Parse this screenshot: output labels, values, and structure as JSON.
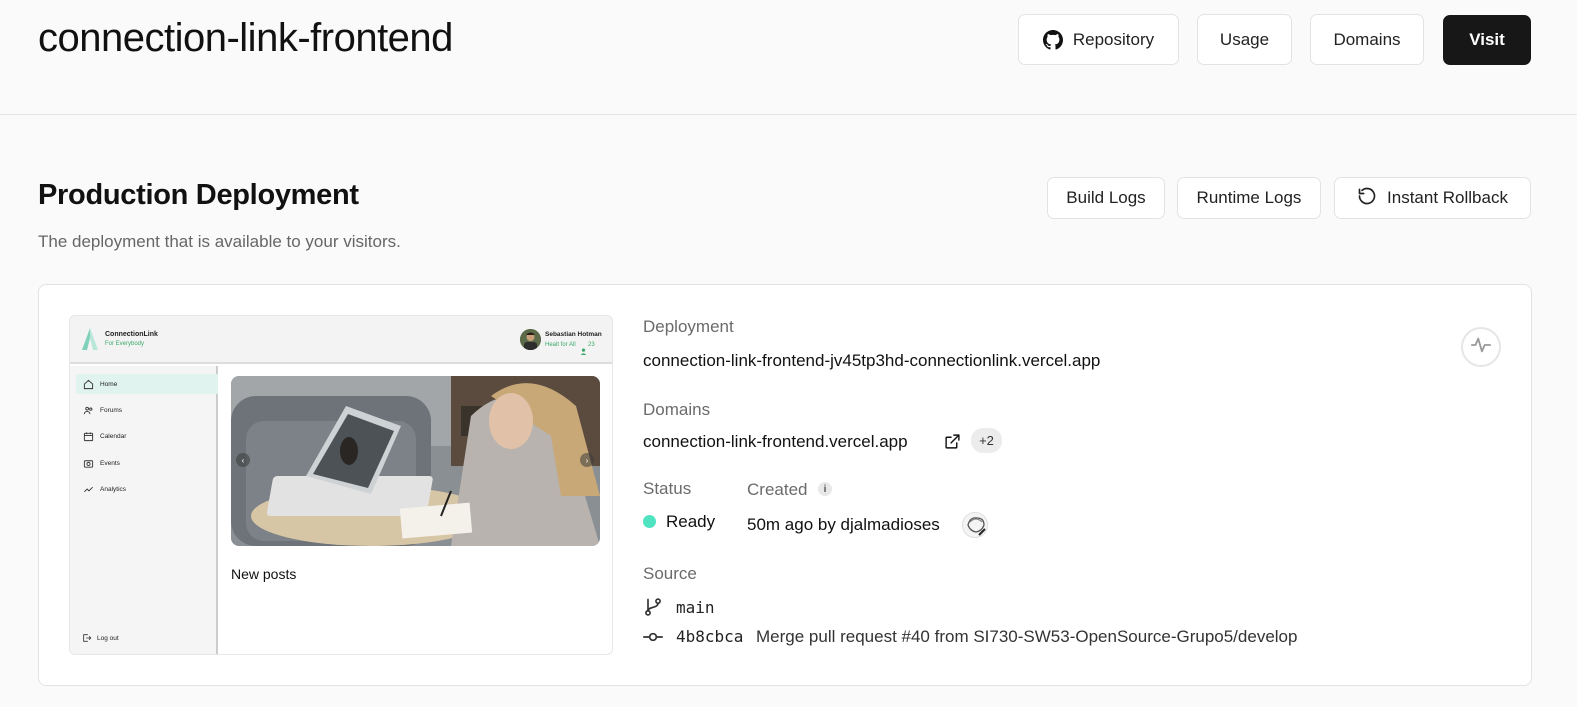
{
  "header": {
    "project_name": "connection-link-frontend",
    "buttons": {
      "repository": "Repository",
      "usage": "Usage",
      "domains": "Domains",
      "visit": "Visit"
    }
  },
  "section": {
    "title": "Production Deployment",
    "subtitle": "The deployment that is available to your visitors.",
    "actions": {
      "build_logs": "Build Logs",
      "runtime_logs": "Runtime Logs",
      "instant_rollback": "Instant Rollback"
    }
  },
  "preview": {
    "brand": "ConnectionLink",
    "tagline": "For Everybody",
    "user_name": "Sebastian Hotman",
    "user_sub": "Healt for All",
    "user_count": "23",
    "nav": [
      "Home",
      "Forums",
      "Calendar",
      "Events",
      "Analytics"
    ],
    "logout": "Log out",
    "arrow_left": "‹",
    "arrow_right": "›",
    "new_posts": "New posts"
  },
  "details": {
    "deployment_label": "Deployment",
    "deployment_url": "connection-link-frontend-jv45tp3hd-connectionlink.vercel.app",
    "domains_label": "Domains",
    "domain": "connection-link-frontend.vercel.app",
    "domains_extra": "+2",
    "status_label": "Status",
    "status_value": "Ready",
    "created_label": "Created",
    "created_info": "i",
    "created_value": "50m ago by djalmadioses",
    "source_label": "Source",
    "branch": "main",
    "commit_hash": "4b8cbca",
    "commit_message": "Merge pull request #40 from SI730-SW53-OpenSource-Grupo5/develop"
  },
  "colors": {
    "ready": "#50e3c2",
    "accent_dark": "#171717",
    "preview_green": "#3aaa6a"
  }
}
